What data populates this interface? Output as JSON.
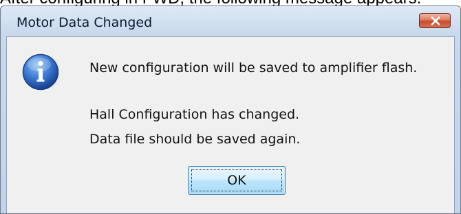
{
  "background_text": "After configuring in FWD, the following message appears:",
  "dialog": {
    "title": "Motor Data Changed",
    "icon": "information-icon",
    "messages": [
      "New configuration will be saved to amplifier flash.",
      "Hall Configuration has changed.",
      "Data file should be saved again."
    ],
    "ok_label": "OK",
    "close_icon": "close-icon"
  },
  "colors": {
    "close_button": "#c74b2c",
    "info_icon": "#2a5fb5",
    "ok_button_border": "#3c7fb1"
  }
}
